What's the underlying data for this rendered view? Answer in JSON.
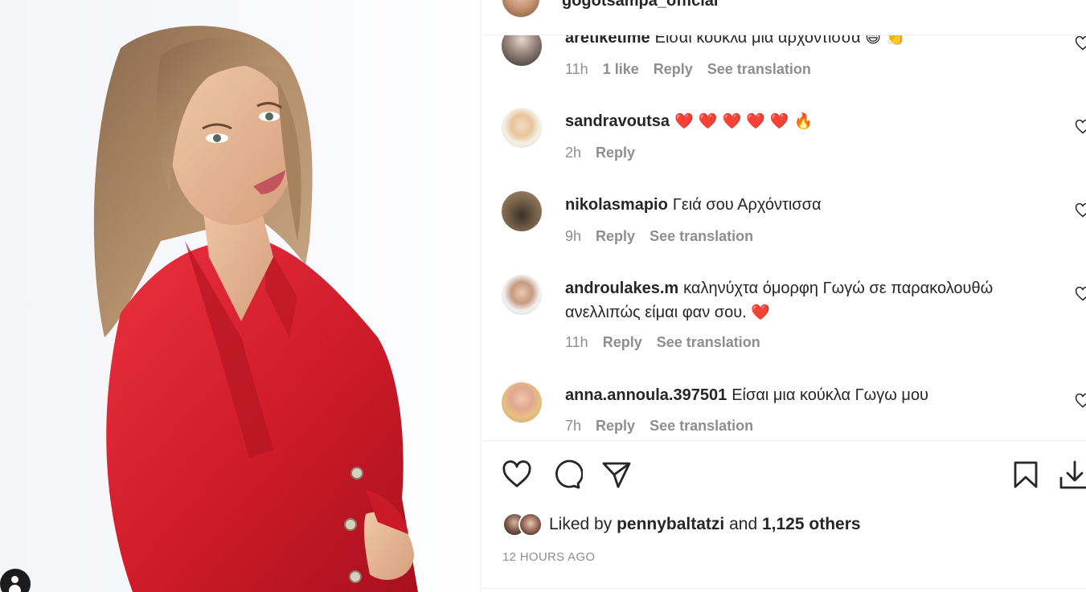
{
  "post": {
    "author_username": "gogotsampa_official"
  },
  "comments": [
    {
      "username": "aretiketime",
      "text": "Είσαι κούκλα μια αρχόντισσα",
      "emoji": "😄 👏",
      "time": "11h",
      "likes": "1 like",
      "reply": "Reply",
      "translate": "See translation"
    },
    {
      "username": "sandravoutsa",
      "text": "",
      "emoji": "❤️ ❤️ ❤️ ❤️ ❤️ 🔥",
      "time": "2h",
      "reply": "Reply"
    },
    {
      "username": "nikolasmapio",
      "text": "Γειά σου Αρχόντισσα",
      "time": "9h",
      "reply": "Reply",
      "translate": "See translation"
    },
    {
      "username": "androulakes.m",
      "text": "καληνύχτα όμορφη Γωγώ σε παρακολουθώ ανελλιπώς είμαι φαν σου.",
      "emoji": "❤️",
      "time": "11h",
      "reply": "Reply",
      "translate": "See translation"
    },
    {
      "username": "anna.annoula.397501",
      "text": "Είσαι μια κούκλα Γωγω μου",
      "time": "7h",
      "reply": "Reply",
      "translate": "See translation"
    }
  ],
  "actions": {
    "like_icon": "heart-outline-icon",
    "comment_icon": "comment-bubble-icon",
    "share_icon": "paper-plane-icon",
    "save_icon": "bookmark-icon",
    "download_icon": "download-icon"
  },
  "likes": {
    "prefix": "Liked by",
    "user": "pennybaltatzi",
    "joiner": "and",
    "others": "1,125 others"
  },
  "timestamp": "12 HOURS AGO",
  "colors": {
    "text": "#262626",
    "meta": "#8e8e8e",
    "heart_red": "#ed2b3b",
    "blazer_red": "#d81e2c"
  }
}
